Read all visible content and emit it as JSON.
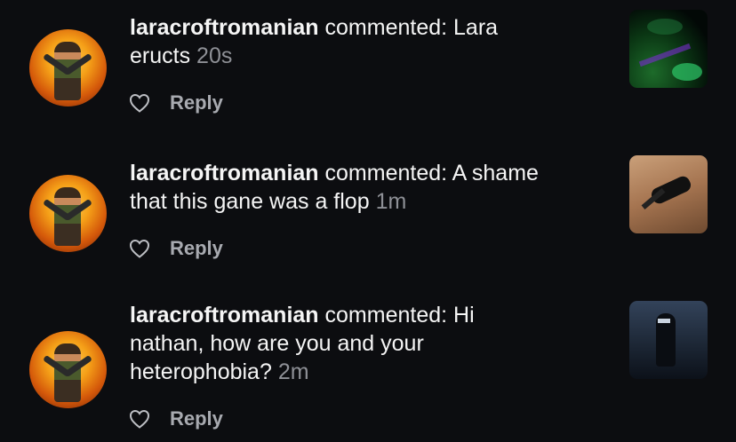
{
  "comments": [
    {
      "username": "laracroftromanian",
      "action": " commented: ",
      "line1": "Lara",
      "line2": "eructs",
      "line3": "",
      "time": "20s",
      "reply": "Reply"
    },
    {
      "username": "laracroftromanian",
      "action": " commented: ",
      "line1": "A shame",
      "line2": "that this gane was a flop",
      "line3": "",
      "time": "1m",
      "reply": "Reply"
    },
    {
      "username": "laracroftromanian",
      "action": " commented: ",
      "line1": "Hi",
      "line2": "nathan, how are you and your",
      "line3": "heterophobia?",
      "time": "2m",
      "reply": "Reply"
    }
  ],
  "icons": {
    "like": "heart-outline-icon"
  },
  "colors": {
    "background": "#0c0d10",
    "text": "#f5f5f5",
    "muted": "#8e9096",
    "reply": "#a8aab0"
  }
}
